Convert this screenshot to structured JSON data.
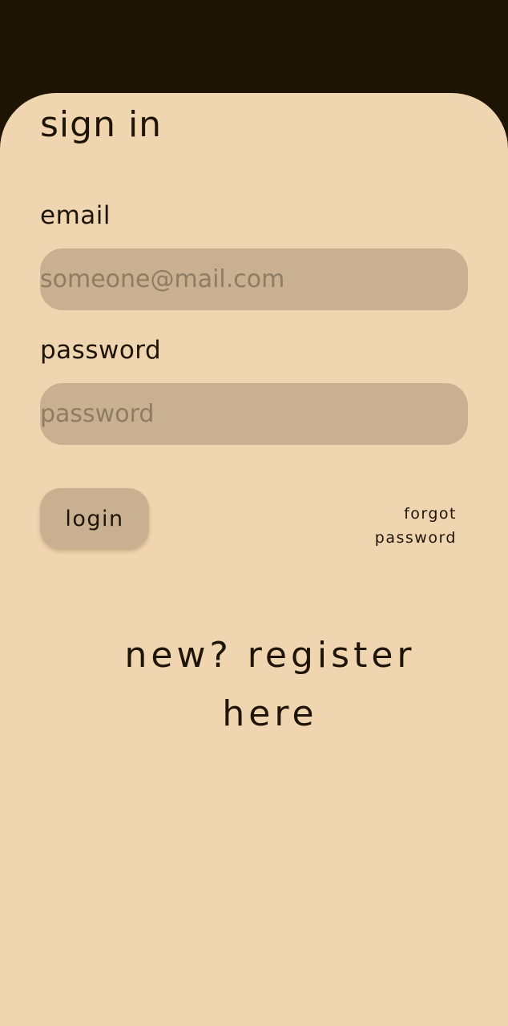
{
  "screen": {
    "title": "sign in"
  },
  "email": {
    "label": "email",
    "placeholder": "someone@mail.com",
    "value": ""
  },
  "password": {
    "label": "password",
    "placeholder": "password",
    "value": ""
  },
  "actions": {
    "login_label": "login",
    "forgot_label": "forgot password",
    "register_label": "new? register here"
  },
  "colors": {
    "header_background": "#1e1404",
    "sheet_background": "#efd5b0",
    "field_background": "#c8b090",
    "text": "#1e1508",
    "placeholder": "#8e7c63"
  }
}
